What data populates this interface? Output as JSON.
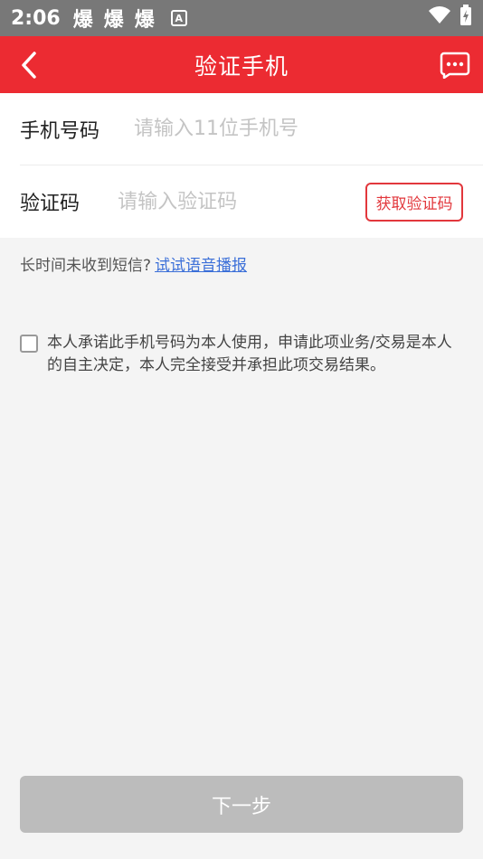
{
  "status_bar": {
    "time": "2:06",
    "notifications": [
      "爆",
      "爆",
      "爆"
    ],
    "badge": "A",
    "icons": [
      "wifi-icon",
      "battery-charging-icon"
    ]
  },
  "nav": {
    "title": "验证手机",
    "back_icon": "chevron-left-icon",
    "more_icon": "chat-more-icon",
    "background": "#ec2b32"
  },
  "form": {
    "phone": {
      "label": "手机号码",
      "placeholder": "请输入11位手机号",
      "value": ""
    },
    "code": {
      "label": "验证码",
      "placeholder": "请输入验证码",
      "value": "",
      "button_label": "获取验证码"
    }
  },
  "hint": {
    "text": "长时间未收到短信?",
    "link": "试试语音播报"
  },
  "agreement": {
    "checked": false,
    "text": "本人承诺此手机号码为本人使用，申请此项业务/交易是本人的自主决定，本人完全接受并承担此项交易结果。"
  },
  "next_button": {
    "label": "下一步",
    "enabled": false
  }
}
